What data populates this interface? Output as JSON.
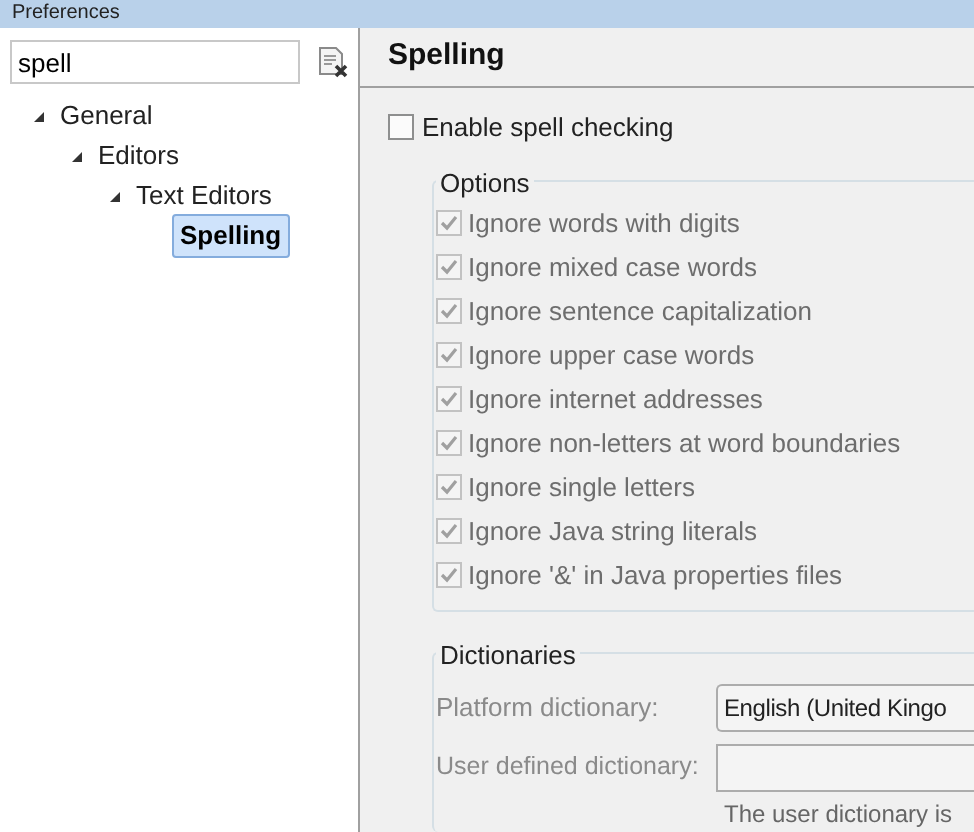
{
  "window": {
    "title": "Preferences"
  },
  "filter": {
    "value": "spell"
  },
  "tree": [
    {
      "label": "General",
      "expanded": true,
      "selected": false,
      "children": [
        {
          "label": "Editors",
          "expanded": true,
          "selected": false,
          "children": [
            {
              "label": "Text Editors",
              "expanded": true,
              "selected": false,
              "children": [
                {
                  "label": "Spelling",
                  "selected": true
                }
              ]
            }
          ]
        }
      ]
    }
  ],
  "page": {
    "title": "Spelling",
    "enable": {
      "label": "Enable spell checking",
      "checked": false
    },
    "options": {
      "title": "Options",
      "items": [
        {
          "label": "Ignore words with digits",
          "checked": true,
          "disabled": true
        },
        {
          "label": "Ignore mixed case words",
          "checked": true,
          "disabled": true
        },
        {
          "label": "Ignore sentence capitalization",
          "checked": true,
          "disabled": true
        },
        {
          "label": "Ignore upper case words",
          "checked": true,
          "disabled": true
        },
        {
          "label": "Ignore internet addresses",
          "checked": true,
          "disabled": true
        },
        {
          "label": "Ignore non-letters at word boundaries",
          "checked": true,
          "disabled": true
        },
        {
          "label": "Ignore single letters",
          "checked": true,
          "disabled": true
        },
        {
          "label": "Ignore Java string literals",
          "checked": true,
          "disabled": true
        },
        {
          "label": "Ignore '&' in Java properties files",
          "checked": true,
          "disabled": true
        }
      ]
    },
    "dictionaries": {
      "title": "Dictionaries",
      "platform": {
        "label": "Platform dictionary:",
        "value": "English (United Kingo"
      },
      "user": {
        "label": "User defined dictionary:"
      },
      "note": "The user dictionary is"
    }
  }
}
